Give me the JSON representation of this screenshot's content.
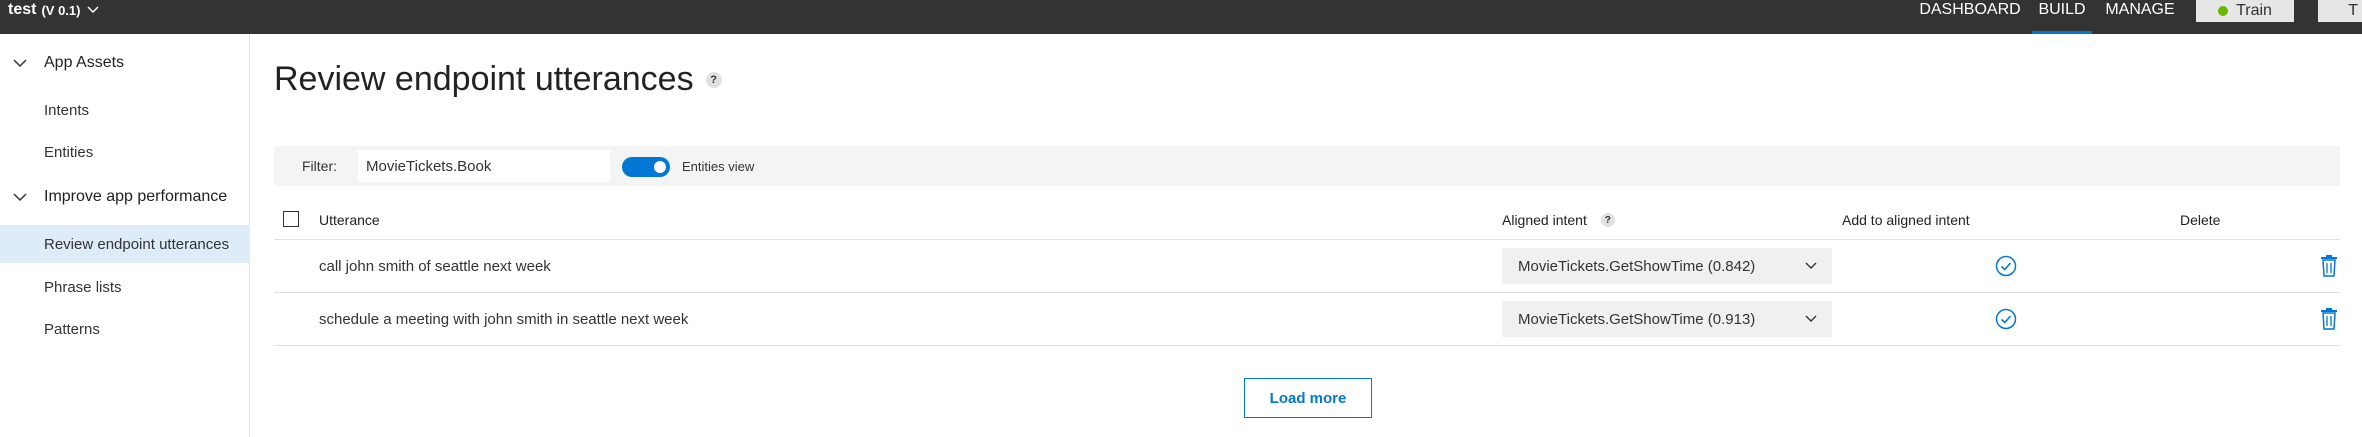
{
  "app": {
    "name": "test",
    "version": "(V 0.1)"
  },
  "nav": {
    "dashboard": "DASHBOARD",
    "build": "BUILD",
    "manage": "MANAGE",
    "train": "Train",
    "extra": "T"
  },
  "sidebar": {
    "section1": "App Assets",
    "items1": [
      "Intents",
      "Entities"
    ],
    "section2": "Improve app performance",
    "items2": [
      "Review endpoint utterances",
      "Phrase lists",
      "Patterns"
    ]
  },
  "page": {
    "title": "Review endpoint utterances",
    "help": "?"
  },
  "filter": {
    "label": "Filter:",
    "value": "MovieTickets.Book",
    "toggle_label": "Entities view",
    "toggle_on": true
  },
  "table": {
    "headers": {
      "utterance": "Utterance",
      "aligned_intent": "Aligned intent",
      "help": "?",
      "add": "Add to aligned intent",
      "delete": "Delete"
    },
    "rows": [
      {
        "utterance": "call john smith of seattle next week",
        "intent": "MovieTickets.GetShowTime (0.842)"
      },
      {
        "utterance": "schedule a meeting with john smith in seattle next week",
        "intent": "MovieTickets.GetShowTime (0.913)"
      }
    ]
  },
  "load_more": "Load more",
  "colors": {
    "accent": "#0078d4",
    "topbar": "#333333",
    "train_dot": "#6bb700",
    "active_item": "#deecf9"
  }
}
